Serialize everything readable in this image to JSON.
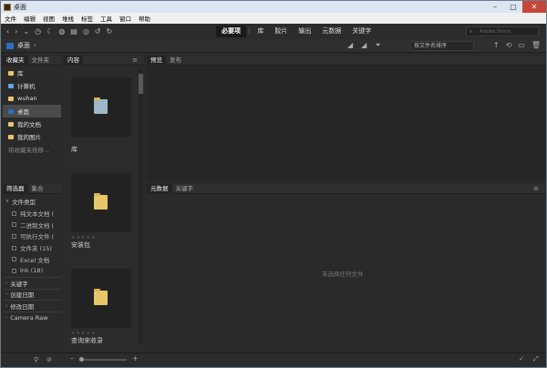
{
  "window": {
    "title": "桌面"
  },
  "menu": [
    "文件",
    "编辑",
    "视图",
    "堆栈",
    "标签",
    "工具",
    "窗口",
    "帮助"
  ],
  "workspaces": [
    {
      "label": "必要项",
      "active": true
    },
    {
      "label": "库",
      "active": false
    },
    {
      "label": "胶片",
      "active": false
    },
    {
      "label": "输出",
      "active": false
    },
    {
      "label": "元数据",
      "active": false
    },
    {
      "label": "关键字",
      "active": false
    }
  ],
  "search": {
    "placeholder": "Adobe Stock"
  },
  "path": {
    "current": "桌面"
  },
  "sort": {
    "label": "按文件名排序"
  },
  "favorites_panel": {
    "tabs": [
      "收藏夹",
      "文件夹"
    ],
    "items": [
      {
        "label": "库",
        "icon": "folder-icon",
        "color": "#e8c66a",
        "selected": false
      },
      {
        "label": "计算机",
        "icon": "computer-icon",
        "color": "#6aa0e0",
        "selected": false
      },
      {
        "label": "wuhan",
        "icon": "folder-icon",
        "color": "#e8c66a",
        "selected": false
      },
      {
        "label": "桌面",
        "icon": "desktop-icon",
        "color": "#2b70c2",
        "selected": true
      },
      {
        "label": "我的文档",
        "icon": "folder-icon",
        "color": "#e8c66a",
        "selected": false
      },
      {
        "label": "我的图片",
        "icon": "folder-icon",
        "color": "#e8c66a",
        "selected": false
      }
    ],
    "hint": "将收藏夹拖移..."
  },
  "filter_panel": {
    "tabs": [
      "筛选器",
      "集合"
    ],
    "sections": [
      {
        "label": "文件类型",
        "expanded": true,
        "children": [
          "纯文本文档 (",
          "二进制文档 (",
          "可执行文件 (",
          "文件夹 (15)",
          "Excel 文档",
          "lnk (18)"
        ]
      },
      {
        "label": "关键字",
        "expanded": false
      },
      {
        "label": "创建日期",
        "expanded": false
      },
      {
        "label": "修改日期",
        "expanded": false
      },
      {
        "label": "Camera Raw",
        "expanded": false
      }
    ]
  },
  "content_panel": {
    "tab": "内容",
    "items": [
      {
        "name": "库",
        "stars": false
      },
      {
        "name": "安装包",
        "stars": true
      },
      {
        "name": "查询来收录",
        "stars": true
      }
    ]
  },
  "preview_panel": {
    "tabs": [
      "预览",
      "发布"
    ]
  },
  "metadata_panel": {
    "tabs": [
      "元数据",
      "关键字"
    ],
    "empty_text": "未选择任何文件"
  }
}
